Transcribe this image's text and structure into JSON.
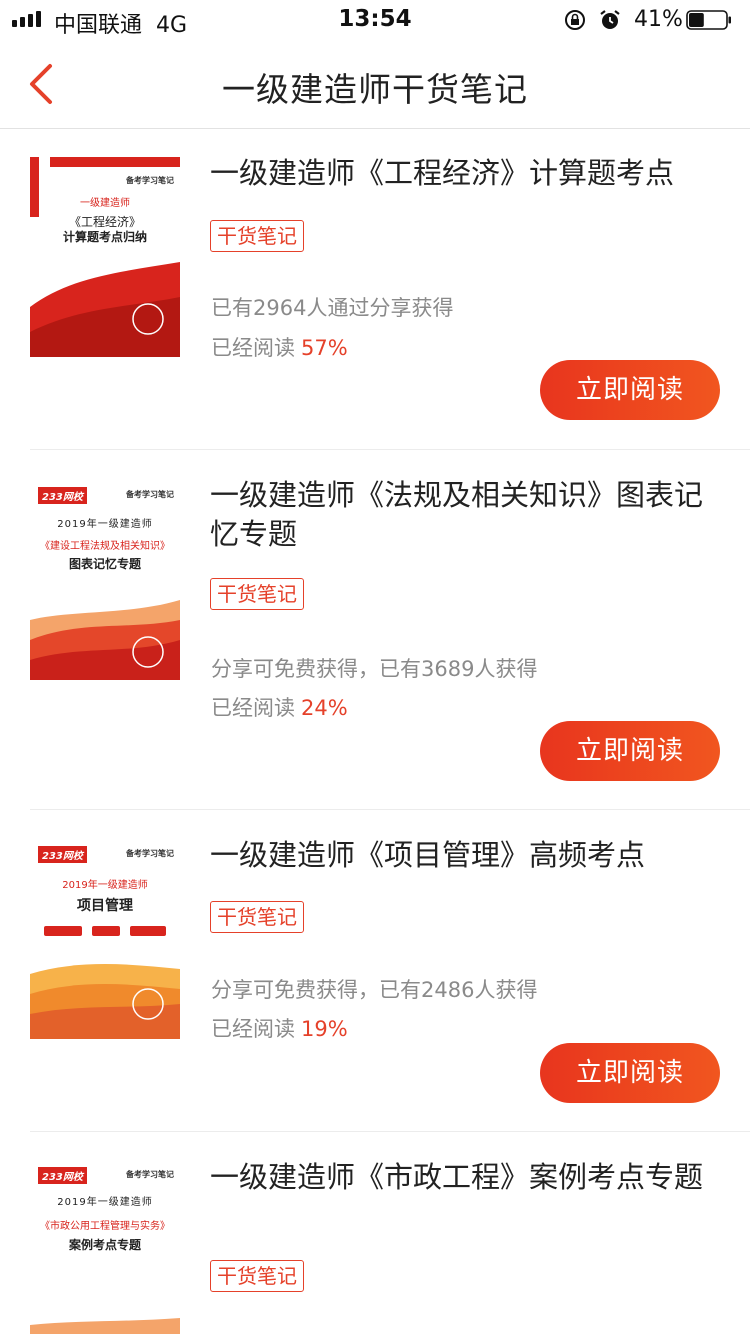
{
  "status_bar": {
    "carrier": "中国联通",
    "network": "4G",
    "time": "13:54",
    "battery_percent": "41%",
    "battery_level": 0.41
  },
  "nav": {
    "title": "一级建造师干货笔记"
  },
  "colors": {
    "accent": "#e5412a",
    "button_gradient_start": "#e8351e",
    "button_gradient_end": "#f1561f"
  },
  "items": [
    {
      "title": "一级建造师《工程经济》计算题考点",
      "tag": "干货笔记",
      "share_text": "已有2964人通过分享获得",
      "read_label": "已经阅读",
      "read_percent": "57%",
      "button": "立即阅读",
      "cover": {
        "line1": "一级建造师",
        "line2": "《工程经济》",
        "line3": "计算题考点归纳"
      }
    },
    {
      "title": "一级建造师《法规及相关知识》图表记忆专题",
      "tag": "干货笔记",
      "share_text": "分享可免费获得，已有3689人获得",
      "read_label": "已经阅读",
      "read_percent": "24%",
      "button": "立即阅读",
      "cover": {
        "line1": "2019年一级建造师",
        "line2": "《建设工程法规及相关知识》",
        "line3": "图表记忆专题"
      }
    },
    {
      "title": "一级建造师《项目管理》高频考点",
      "tag": "干货笔记",
      "share_text": "分享可免费获得，已有2486人获得",
      "read_label": "已经阅读",
      "read_percent": "19%",
      "button": "立即阅读",
      "cover": {
        "line1": "2019年一级建造师",
        "line2": "项目管理",
        "line3": ""
      }
    },
    {
      "title": "一级建造师《市政工程》案例考点专题",
      "tag": "干货笔记",
      "share_text": "",
      "read_label": "",
      "read_percent": "",
      "button": "",
      "cover": {
        "line1": "2019年一级建造师",
        "line2": "《市政公用工程管理与实务》",
        "line3": "案例考点专题"
      }
    }
  ]
}
